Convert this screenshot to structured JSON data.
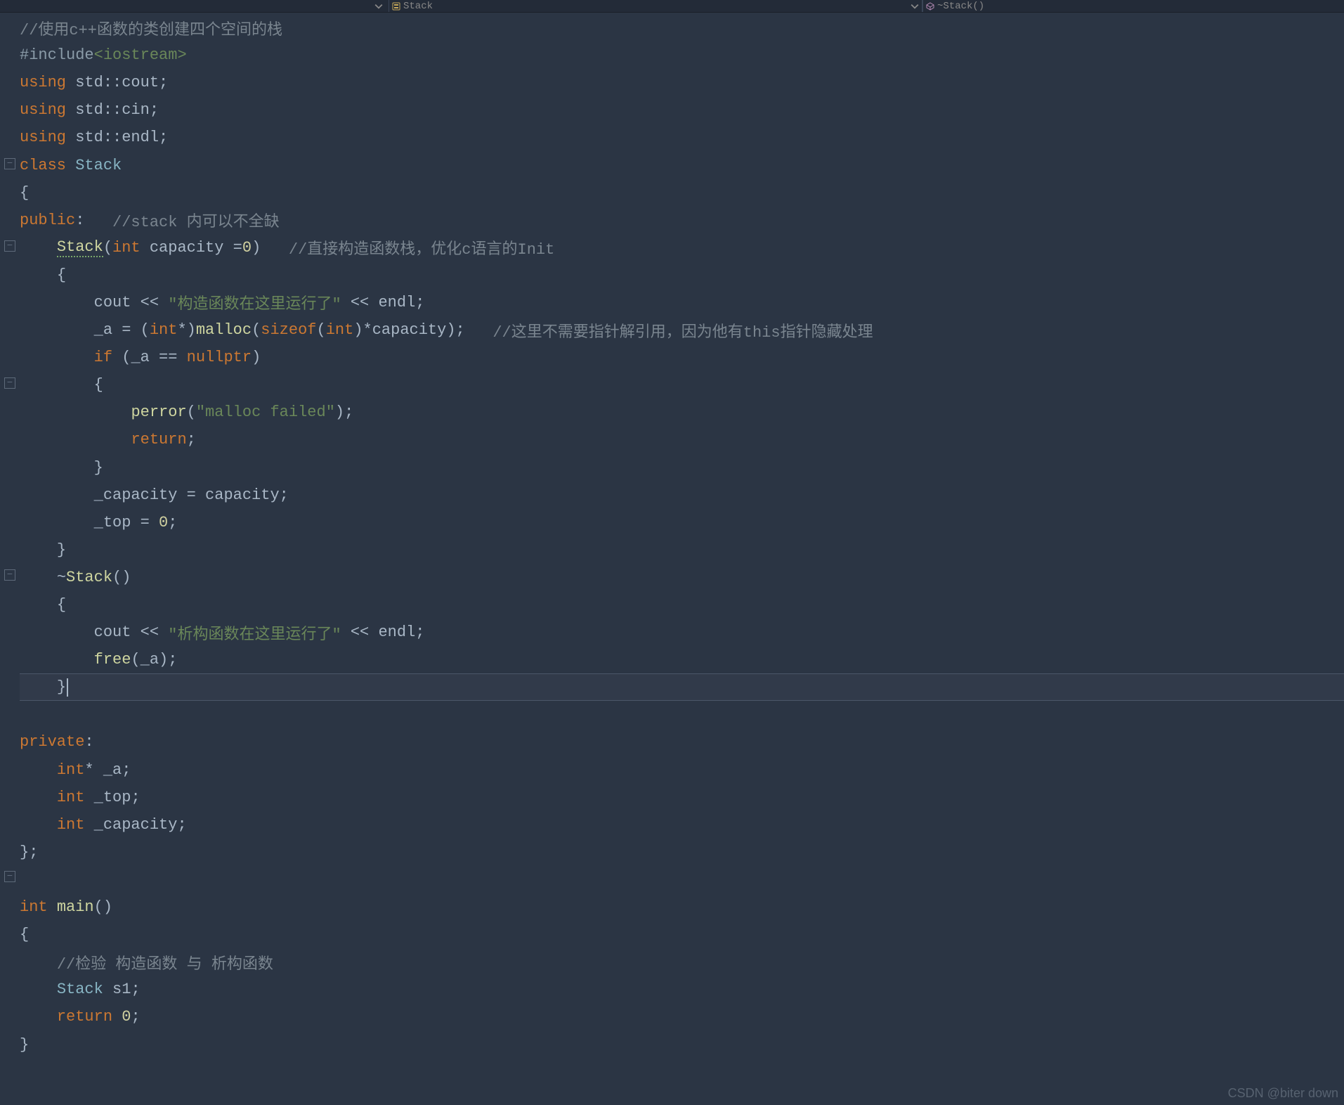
{
  "topbar": {
    "left_dropdown": "",
    "mid_icon": "struct-icon",
    "mid_label": "Stack",
    "right_icon": "cube-icon",
    "right_label": "~Stack()"
  },
  "gutter": {
    "folds": [
      "",
      "",
      "",
      "",
      "",
      "⊟",
      "",
      "",
      "⊟",
      "",
      "",
      "",
      "",
      "⊟",
      "",
      "",
      "",
      "",
      "",
      "",
      "⊟",
      "",
      "",
      "",
      "",
      "",
      "",
      "",
      "",
      "",
      "",
      "⊟",
      "",
      "",
      "",
      "",
      ""
    ]
  },
  "code": [
    [
      [
        "c-comment",
        "//使用c++函数的类创建四个空间的栈"
      ]
    ],
    [
      [
        "c-preproc",
        "#include"
      ],
      [
        "c-include",
        "<iostream>"
      ]
    ],
    [
      [
        "c-keyword",
        "using "
      ],
      [
        "c-ns",
        "std::"
      ],
      [
        "c-ident",
        "cout"
      ],
      [
        "c-punct",
        ";"
      ]
    ],
    [
      [
        "c-keyword",
        "using "
      ],
      [
        "c-ns",
        "std::"
      ],
      [
        "c-ident",
        "cin"
      ],
      [
        "c-punct",
        ";"
      ]
    ],
    [
      [
        "c-keyword",
        "using "
      ],
      [
        "c-ns",
        "std::"
      ],
      [
        "c-ident",
        "endl"
      ],
      [
        "c-punct",
        ";"
      ]
    ],
    [
      [
        "c-keyword",
        "class "
      ],
      [
        "c-class",
        "Stack"
      ]
    ],
    [
      [
        "c-punct",
        "{"
      ]
    ],
    [
      [
        "c-keyword",
        "public"
      ],
      [
        "c-punct",
        ":   "
      ],
      [
        "c-comment",
        "//stack 内可以不全缺"
      ]
    ],
    [
      [
        "c-ident",
        "    "
      ],
      [
        "c-func squiggle",
        "Stack"
      ],
      [
        "c-punct",
        "("
      ],
      [
        "c-keyword",
        "int "
      ],
      [
        "c-ident",
        "capacity ="
      ],
      [
        "c-num",
        "0"
      ],
      [
        "c-punct",
        ")   "
      ],
      [
        "c-comment",
        "//直接构造函数栈，优化c语言的Init"
      ]
    ],
    [
      [
        "c-ident",
        "    "
      ],
      [
        "c-punct",
        "{"
      ]
    ],
    [
      [
        "c-ident",
        "        cout "
      ],
      [
        "c-op",
        "<< "
      ],
      [
        "c-str",
        "\"构造函数在这里运行了\""
      ],
      [
        "c-op",
        " << "
      ],
      [
        "c-ident",
        "endl"
      ],
      [
        "c-punct",
        ";"
      ]
    ],
    [
      [
        "c-ident",
        "        _a "
      ],
      [
        "c-op",
        "= "
      ],
      [
        "c-punct",
        "("
      ],
      [
        "c-keyword",
        "int"
      ],
      [
        "c-op",
        "*"
      ],
      [
        "c-punct",
        ")"
      ],
      [
        "c-func",
        "malloc"
      ],
      [
        "c-punct",
        "("
      ],
      [
        "c-keyword",
        "sizeof"
      ],
      [
        "c-punct",
        "("
      ],
      [
        "c-keyword",
        "int"
      ],
      [
        "c-punct",
        ")"
      ],
      [
        "c-op",
        "*"
      ],
      [
        "c-ident",
        "capacity"
      ],
      [
        "c-punct",
        ");   "
      ],
      [
        "c-comment",
        "//这里不需要指针解引用，因为他有this指针隐藏处理"
      ]
    ],
    [
      [
        "c-ident",
        "        "
      ],
      [
        "c-keyword",
        "if "
      ],
      [
        "c-punct",
        "("
      ],
      [
        "c-ident",
        "_a "
      ],
      [
        "c-op",
        "== "
      ],
      [
        "c-nullptr",
        "nullptr"
      ],
      [
        "c-punct",
        ")"
      ]
    ],
    [
      [
        "c-ident",
        "        "
      ],
      [
        "c-punct",
        "{"
      ]
    ],
    [
      [
        "c-ident",
        "            "
      ],
      [
        "c-func",
        "perror"
      ],
      [
        "c-punct",
        "("
      ],
      [
        "c-str",
        "\"malloc failed\""
      ],
      [
        "c-punct",
        ");"
      ]
    ],
    [
      [
        "c-ident",
        "            "
      ],
      [
        "c-keyword",
        "return"
      ],
      [
        "c-punct",
        ";"
      ]
    ],
    [
      [
        "c-ident",
        "        "
      ],
      [
        "c-punct",
        "}"
      ]
    ],
    [
      [
        "c-ident",
        "        _capacity "
      ],
      [
        "c-op",
        "= "
      ],
      [
        "c-ident",
        "capacity"
      ],
      [
        "c-punct",
        ";"
      ]
    ],
    [
      [
        "c-ident",
        "        _top "
      ],
      [
        "c-op",
        "= "
      ],
      [
        "c-num",
        "0"
      ],
      [
        "c-punct",
        ";"
      ]
    ],
    [
      [
        "c-ident",
        "    "
      ],
      [
        "c-punct",
        "}"
      ]
    ],
    [
      [
        "c-ident",
        "    "
      ],
      [
        "c-op",
        "~"
      ],
      [
        "c-func",
        "Stack"
      ],
      [
        "c-punct",
        "()"
      ]
    ],
    [
      [
        "c-ident",
        "    "
      ],
      [
        "c-punct",
        "{"
      ]
    ],
    [
      [
        "c-ident",
        "        cout "
      ],
      [
        "c-op",
        "<< "
      ],
      [
        "c-str",
        "\"析构函数在这里运行了\""
      ],
      [
        "c-op",
        " << "
      ],
      [
        "c-ident",
        "endl"
      ],
      [
        "c-punct",
        ";"
      ]
    ],
    [
      [
        "c-ident",
        "        "
      ],
      [
        "c-func",
        "free"
      ],
      [
        "c-punct",
        "("
      ],
      [
        "c-ident",
        "_a"
      ],
      [
        "c-punct",
        ");"
      ]
    ],
    [
      [
        "c-ident",
        "    "
      ],
      [
        "c-punct",
        "}"
      ]
    ],
    [
      [
        "c-ident",
        ""
      ]
    ],
    [
      [
        "c-keyword",
        "private"
      ],
      [
        "c-punct",
        ":"
      ]
    ],
    [
      [
        "c-ident",
        "    "
      ],
      [
        "c-keyword",
        "int"
      ],
      [
        "c-op",
        "* "
      ],
      [
        "c-ident",
        "_a"
      ],
      [
        "c-punct",
        ";"
      ]
    ],
    [
      [
        "c-ident",
        "    "
      ],
      [
        "c-keyword",
        "int "
      ],
      [
        "c-ident",
        "_top"
      ],
      [
        "c-punct",
        ";"
      ]
    ],
    [
      [
        "c-ident",
        "    "
      ],
      [
        "c-keyword",
        "int "
      ],
      [
        "c-ident",
        "_capacity"
      ],
      [
        "c-punct",
        ";"
      ]
    ],
    [
      [
        "c-punct",
        "};"
      ]
    ],
    [
      [
        "c-ident",
        ""
      ]
    ],
    [
      [
        "c-keyword",
        "int "
      ],
      [
        "c-func",
        "main"
      ],
      [
        "c-punct",
        "()"
      ]
    ],
    [
      [
        "c-punct",
        "{"
      ]
    ],
    [
      [
        "c-ident",
        "    "
      ],
      [
        "c-comment",
        "//检验 构造函数 与 析构函数"
      ]
    ],
    [
      [
        "c-ident",
        "    "
      ],
      [
        "c-class",
        "Stack "
      ],
      [
        "c-ident",
        "s1"
      ],
      [
        "c-punct",
        ";"
      ]
    ],
    [
      [
        "c-ident",
        "    "
      ],
      [
        "c-keyword",
        "return "
      ],
      [
        "c-num",
        "0"
      ],
      [
        "c-punct",
        ";"
      ]
    ],
    [
      [
        "c-punct",
        "}"
      ]
    ]
  ],
  "currentLine": 24,
  "watermark": "CSDN @biter down"
}
